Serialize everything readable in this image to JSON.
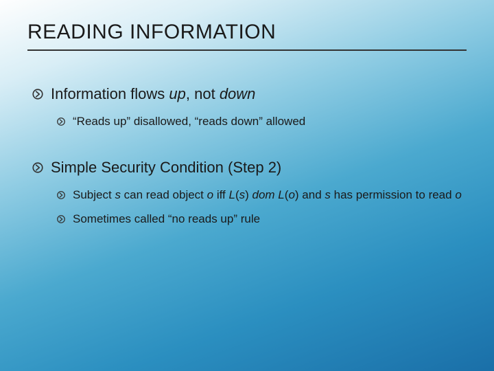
{
  "slide": {
    "title": "READING INFORMATION",
    "items": [
      {
        "text_parts": {
          "a": "Information flows ",
          "b": "up",
          "c": ", not ",
          "d": "down"
        },
        "children": [
          {
            "text": "“Reads up” disallowed, “reads down” allowed"
          }
        ]
      },
      {
        "text": "Simple Security Condition (Step 2)",
        "children": [
          {
            "text_parts": {
              "a": "Subject ",
              "b": "s",
              "c": " can read object ",
              "d": "o",
              "e": " iff ",
              "f": "L",
              "g": "(",
              "h": "s",
              "i": ") ",
              "j": "dom L",
              "k": "(",
              "l": "o",
              "m": ") and ",
              "n": "s",
              "o": " has permission to read ",
              "p": "o"
            }
          },
          {
            "text": "Sometimes called “no reads up” rule"
          }
        ]
      }
    ]
  }
}
